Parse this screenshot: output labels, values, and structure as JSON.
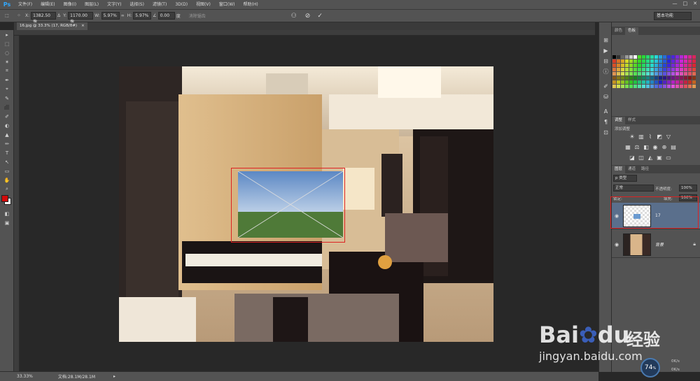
{
  "app": {
    "logo": "Ps"
  },
  "menu": [
    "文件(F)",
    "编辑(E)",
    "图像(I)",
    "图层(L)",
    "文字(Y)",
    "选择(S)",
    "滤镜(T)",
    "3D(D)",
    "视图(V)",
    "窗口(W)",
    "帮助(H)"
  ],
  "window_controls": {
    "minimize": "—",
    "maximize": "□",
    "close": "✕"
  },
  "options": {
    "x_label": "X:",
    "x_value": "1382.50 像",
    "delta_label": "Δ",
    "y_label": "Y:",
    "y_value": "1170.00 像",
    "w_label": "W:",
    "w_value": "5.97%",
    "link_label": "∞",
    "h_label": "H:",
    "h_value": "5.97%",
    "angle_label": "∠",
    "angle_value": "0.00",
    "angle_unit": "度",
    "interp_label": "消除锯齿",
    "cancel_icon": "⊘",
    "commit_icon": "✓",
    "workspace": "基本功能"
  },
  "document_tab": {
    "title": "16.jpg @ 33.3% (17, RGB/8#)",
    "close": "×"
  },
  "tools": [
    "▸",
    "⬚",
    "◌",
    "✶",
    "⌗",
    "✒",
    "⌖",
    "✎",
    "⬛",
    "✐",
    "◐",
    "▲",
    "✏",
    "T",
    "↖",
    "▭",
    "✋",
    "⌕",
    "■",
    "◧",
    "▣"
  ],
  "status": {
    "zoom": "33.33%",
    "doc_info": "文档:28.1M/28.1M",
    "arrow": "▸"
  },
  "panels": {
    "swatch_tabs": [
      "颜色",
      "色板"
    ],
    "adj_tabs": [
      "调整",
      "样式"
    ],
    "adj_add": "添加调整",
    "layer_tabs": [
      "图层",
      "通道",
      "路径"
    ],
    "kind_filter": "p 类型",
    "blend_mode": "正常",
    "opacity_label": "不透明度:",
    "opacity_value": "100%",
    "lock_label": "锁定:",
    "fill_label": "填充:",
    "fill_value": "100%",
    "layers": [
      {
        "name": "17",
        "selected": true
      },
      {
        "name": "背景",
        "selected": false
      }
    ]
  },
  "bottom_widget": {
    "percent": "74",
    "percent_unit": "%",
    "up": "0K/s",
    "down": "0K/s"
  },
  "watermark": {
    "brand": "Bai",
    "paw": "du",
    "cn": "经验",
    "url": "jingyan.baidu.com"
  },
  "colors": {
    "fg": "#d10a0a",
    "bg": "#ffffff",
    "accent": "#31a8ff",
    "selected_layer": "#5a6f8c"
  }
}
